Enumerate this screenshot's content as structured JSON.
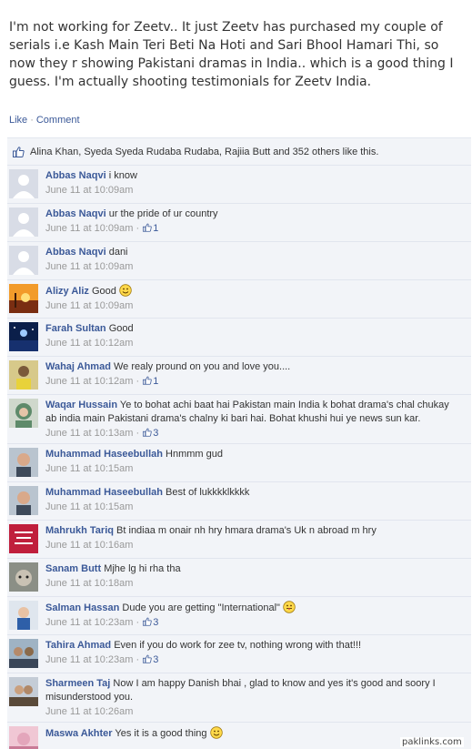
{
  "post": {
    "text": "I'm not working for Zeetv.. It just Zeetv has purchased my couple of serials i.e Kash Main Teri Beti Na Hoti and Sari Bhool Hamari Thi, so now they r showing Pakistani dramas in India.. which is a good thing I guess. I'm actually shooting testimonials for Zeetv India."
  },
  "actions": {
    "like": "Like",
    "separator": "·",
    "comment": "Comment"
  },
  "likes_summary": "Alina Khan, Syeda Syeda Rudaba Rudaba, Rajiia Butt and 352 others like this.",
  "comments": [
    {
      "name": "Abbas Naqvi",
      "text": "i know",
      "time": "June 11 at 10:09am",
      "likes": "",
      "avatar": "default"
    },
    {
      "name": "Abbas Naqvi",
      "text": "ur the pride of ur country",
      "time": "June 11 at 10:09am",
      "likes": "1",
      "avatar": "default"
    },
    {
      "name": "Abbas Naqvi",
      "text": "dani",
      "time": "June 11 at 10:09am",
      "likes": "",
      "avatar": "default"
    },
    {
      "name": "Alizy Aliz",
      "text": "Good",
      "time": "June 11 at 10:09am",
      "likes": "",
      "avatar": "sunset",
      "emoji": "smile"
    },
    {
      "name": "Farah Sultan",
      "text": "Good",
      "time": "June 11 at 10:12am",
      "likes": "",
      "avatar": "night"
    },
    {
      "name": "Wahaj Ahmad",
      "text": "We realy pround on you and love you....",
      "time": "June 11 at 10:12am",
      "likes": "1",
      "avatar": "person-yellow"
    },
    {
      "name": "Waqar Hussain",
      "text": "Ye to bohat achi baat hai Pakistan main India k bohat drama's chal chukay ab india main Pakistani drama's chalny ki bari hai. Bohat khushi hui ye news sun kar.",
      "time": "June 11 at 10:13am",
      "likes": "3",
      "avatar": "hijab",
      "tall": true
    },
    {
      "name": "Muhammad Haseebullah",
      "text": "Hnmmm gud",
      "time": "June 11 at 10:15am",
      "likes": "",
      "avatar": "kid"
    },
    {
      "name": "Muhammad Haseebullah",
      "text": "Best of lukkkklkkkk",
      "time": "June 11 at 10:15am",
      "likes": "",
      "avatar": "kid"
    },
    {
      "name": "Mahrukh Tariq",
      "text": "Bt indiaa m onair nh hry hmara drama's Uk n abroad m hry",
      "time": "June 11 at 10:16am",
      "likes": "",
      "avatar": "keep-calm"
    },
    {
      "name": "Sanam Butt",
      "text": "Mjhe lg hi rha tha",
      "time": "June 11 at 10:18am",
      "likes": "",
      "avatar": "cat"
    },
    {
      "name": "Salman Hassan",
      "text": "Dude you are getting \"International\"",
      "time": "June 11 at 10:23am",
      "likes": "3",
      "avatar": "child",
      "emoji": "tongue"
    },
    {
      "name": "Tahira Ahmad",
      "text": "Even if you do work for zee tv, nothing wrong with that!!!",
      "time": "June 11 at 10:23am",
      "likes": "3",
      "avatar": "group"
    },
    {
      "name": "Sharmeen Taj",
      "text": "Now I am happy Danish bhai , glad to know and yes it's good and soory I misunderstood you.",
      "time": "June 11 at 10:26am",
      "likes": "",
      "avatar": "couple",
      "tall": true
    },
    {
      "name": "Maswa Akhter",
      "text": "Yes it is a good thing",
      "time": "",
      "likes": "",
      "avatar": "pink",
      "emoji": "smile"
    }
  ],
  "watermark": "paklinks.com"
}
